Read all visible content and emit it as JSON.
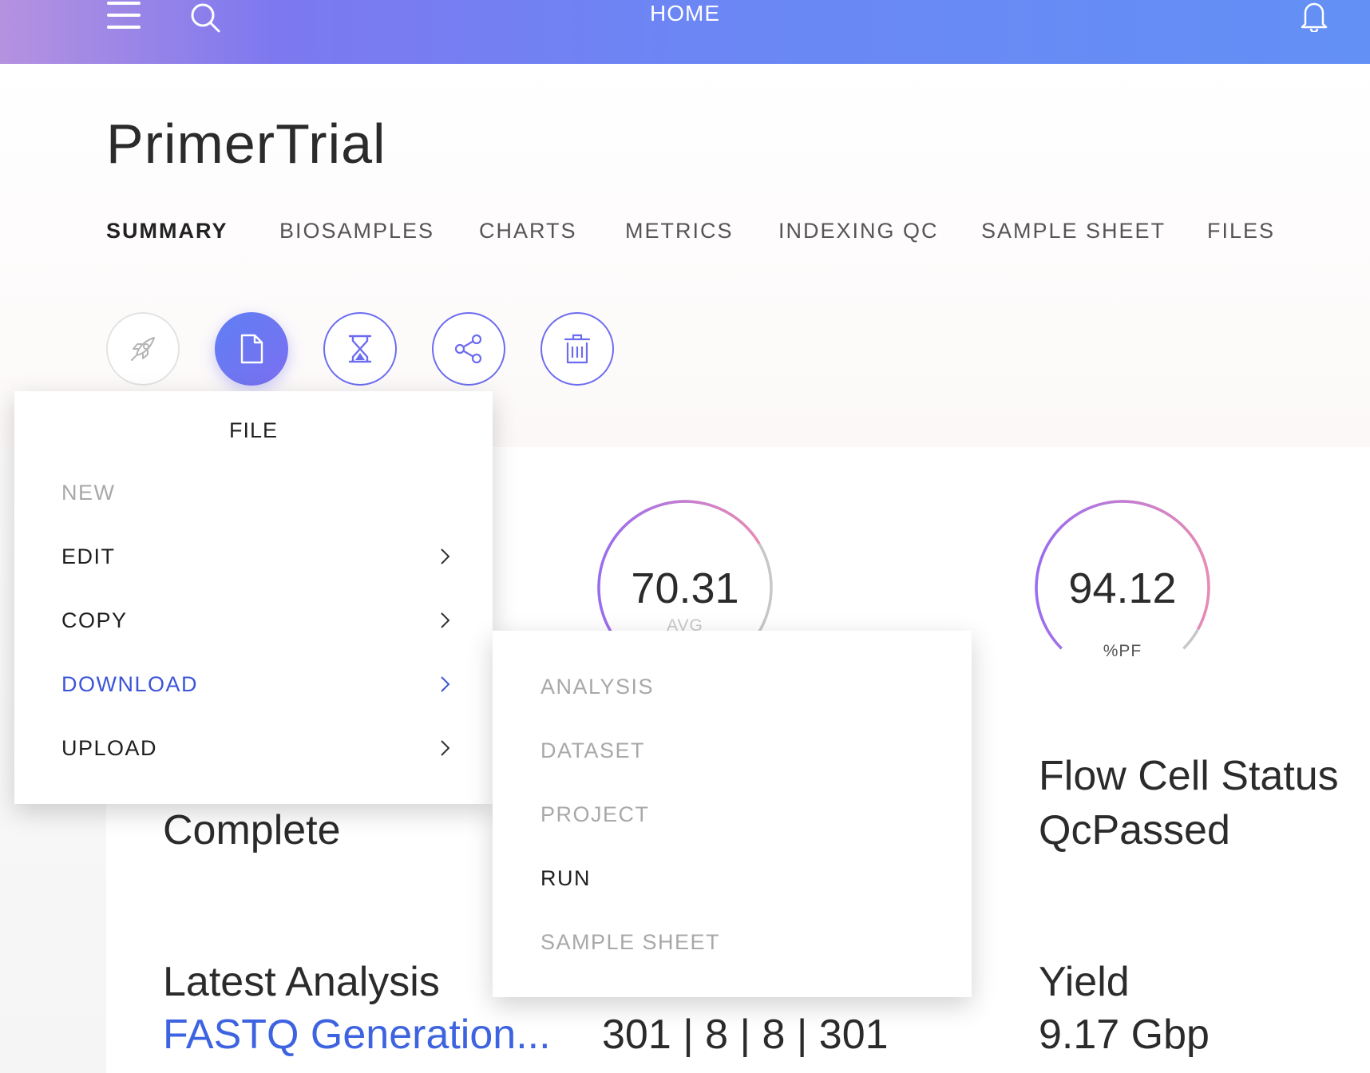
{
  "topbar": {
    "title": "HOME",
    "menu_icon": "hamburger-menu-icon",
    "search_icon": "search-icon",
    "bell_icon": "bell-icon"
  },
  "page": {
    "title": "PrimerTrial"
  },
  "tabs": [
    {
      "label": "SUMMARY",
      "active": true
    },
    {
      "label": "BIOSAMPLES"
    },
    {
      "label": "CHARTS"
    },
    {
      "label": "METRICS"
    },
    {
      "label": "INDEXING QC"
    },
    {
      "label": "SAMPLE SHEET"
    },
    {
      "label": "FILES"
    }
  ],
  "actions": [
    {
      "icon": "rocket-icon",
      "state": "disabled"
    },
    {
      "icon": "file-icon",
      "state": "active"
    },
    {
      "icon": "hourglass-icon"
    },
    {
      "icon": "share-icon"
    },
    {
      "icon": "trash-icon"
    }
  ],
  "gauges": [
    {
      "value": "70.31",
      "label": "AVG",
      "fraction": 0.72
    },
    {
      "value": "94.12",
      "label": "%PF",
      "fraction": 0.94
    }
  ],
  "stats": {
    "status_value": "Complete",
    "flow_cell_label": "Flow Cell Status",
    "flow_cell_value": "QcPassed",
    "latest_analysis_label": "Latest Analysis",
    "latest_analysis_value": "FASTQ Generation...",
    "cycles_value": "301 | 8 | 8 | 301",
    "yield_label": "Yield",
    "yield_value": "9.17 Gbp"
  },
  "file_menu": {
    "title": "FILE",
    "items": [
      {
        "label": "NEW",
        "state": "disabled"
      },
      {
        "label": "EDIT",
        "has_submenu": true
      },
      {
        "label": "COPY",
        "has_submenu": true
      },
      {
        "label": "DOWNLOAD",
        "has_submenu": true,
        "state": "highlight"
      },
      {
        "label": "UPLOAD",
        "has_submenu": true
      }
    ]
  },
  "download_submenu": {
    "items": [
      {
        "label": "ANALYSIS",
        "state": "disabled"
      },
      {
        "label": "DATASET",
        "state": "disabled"
      },
      {
        "label": "PROJECT",
        "state": "disabled"
      },
      {
        "label": "RUN"
      },
      {
        "label": "SAMPLE SHEET",
        "state": "disabled"
      }
    ]
  },
  "colors": {
    "accent": "#6c6cf0",
    "link": "#3d63e0",
    "highlight": "#3c55d8",
    "gauge_start": "#9a6cf0",
    "gauge_end": "#e88bb5"
  }
}
